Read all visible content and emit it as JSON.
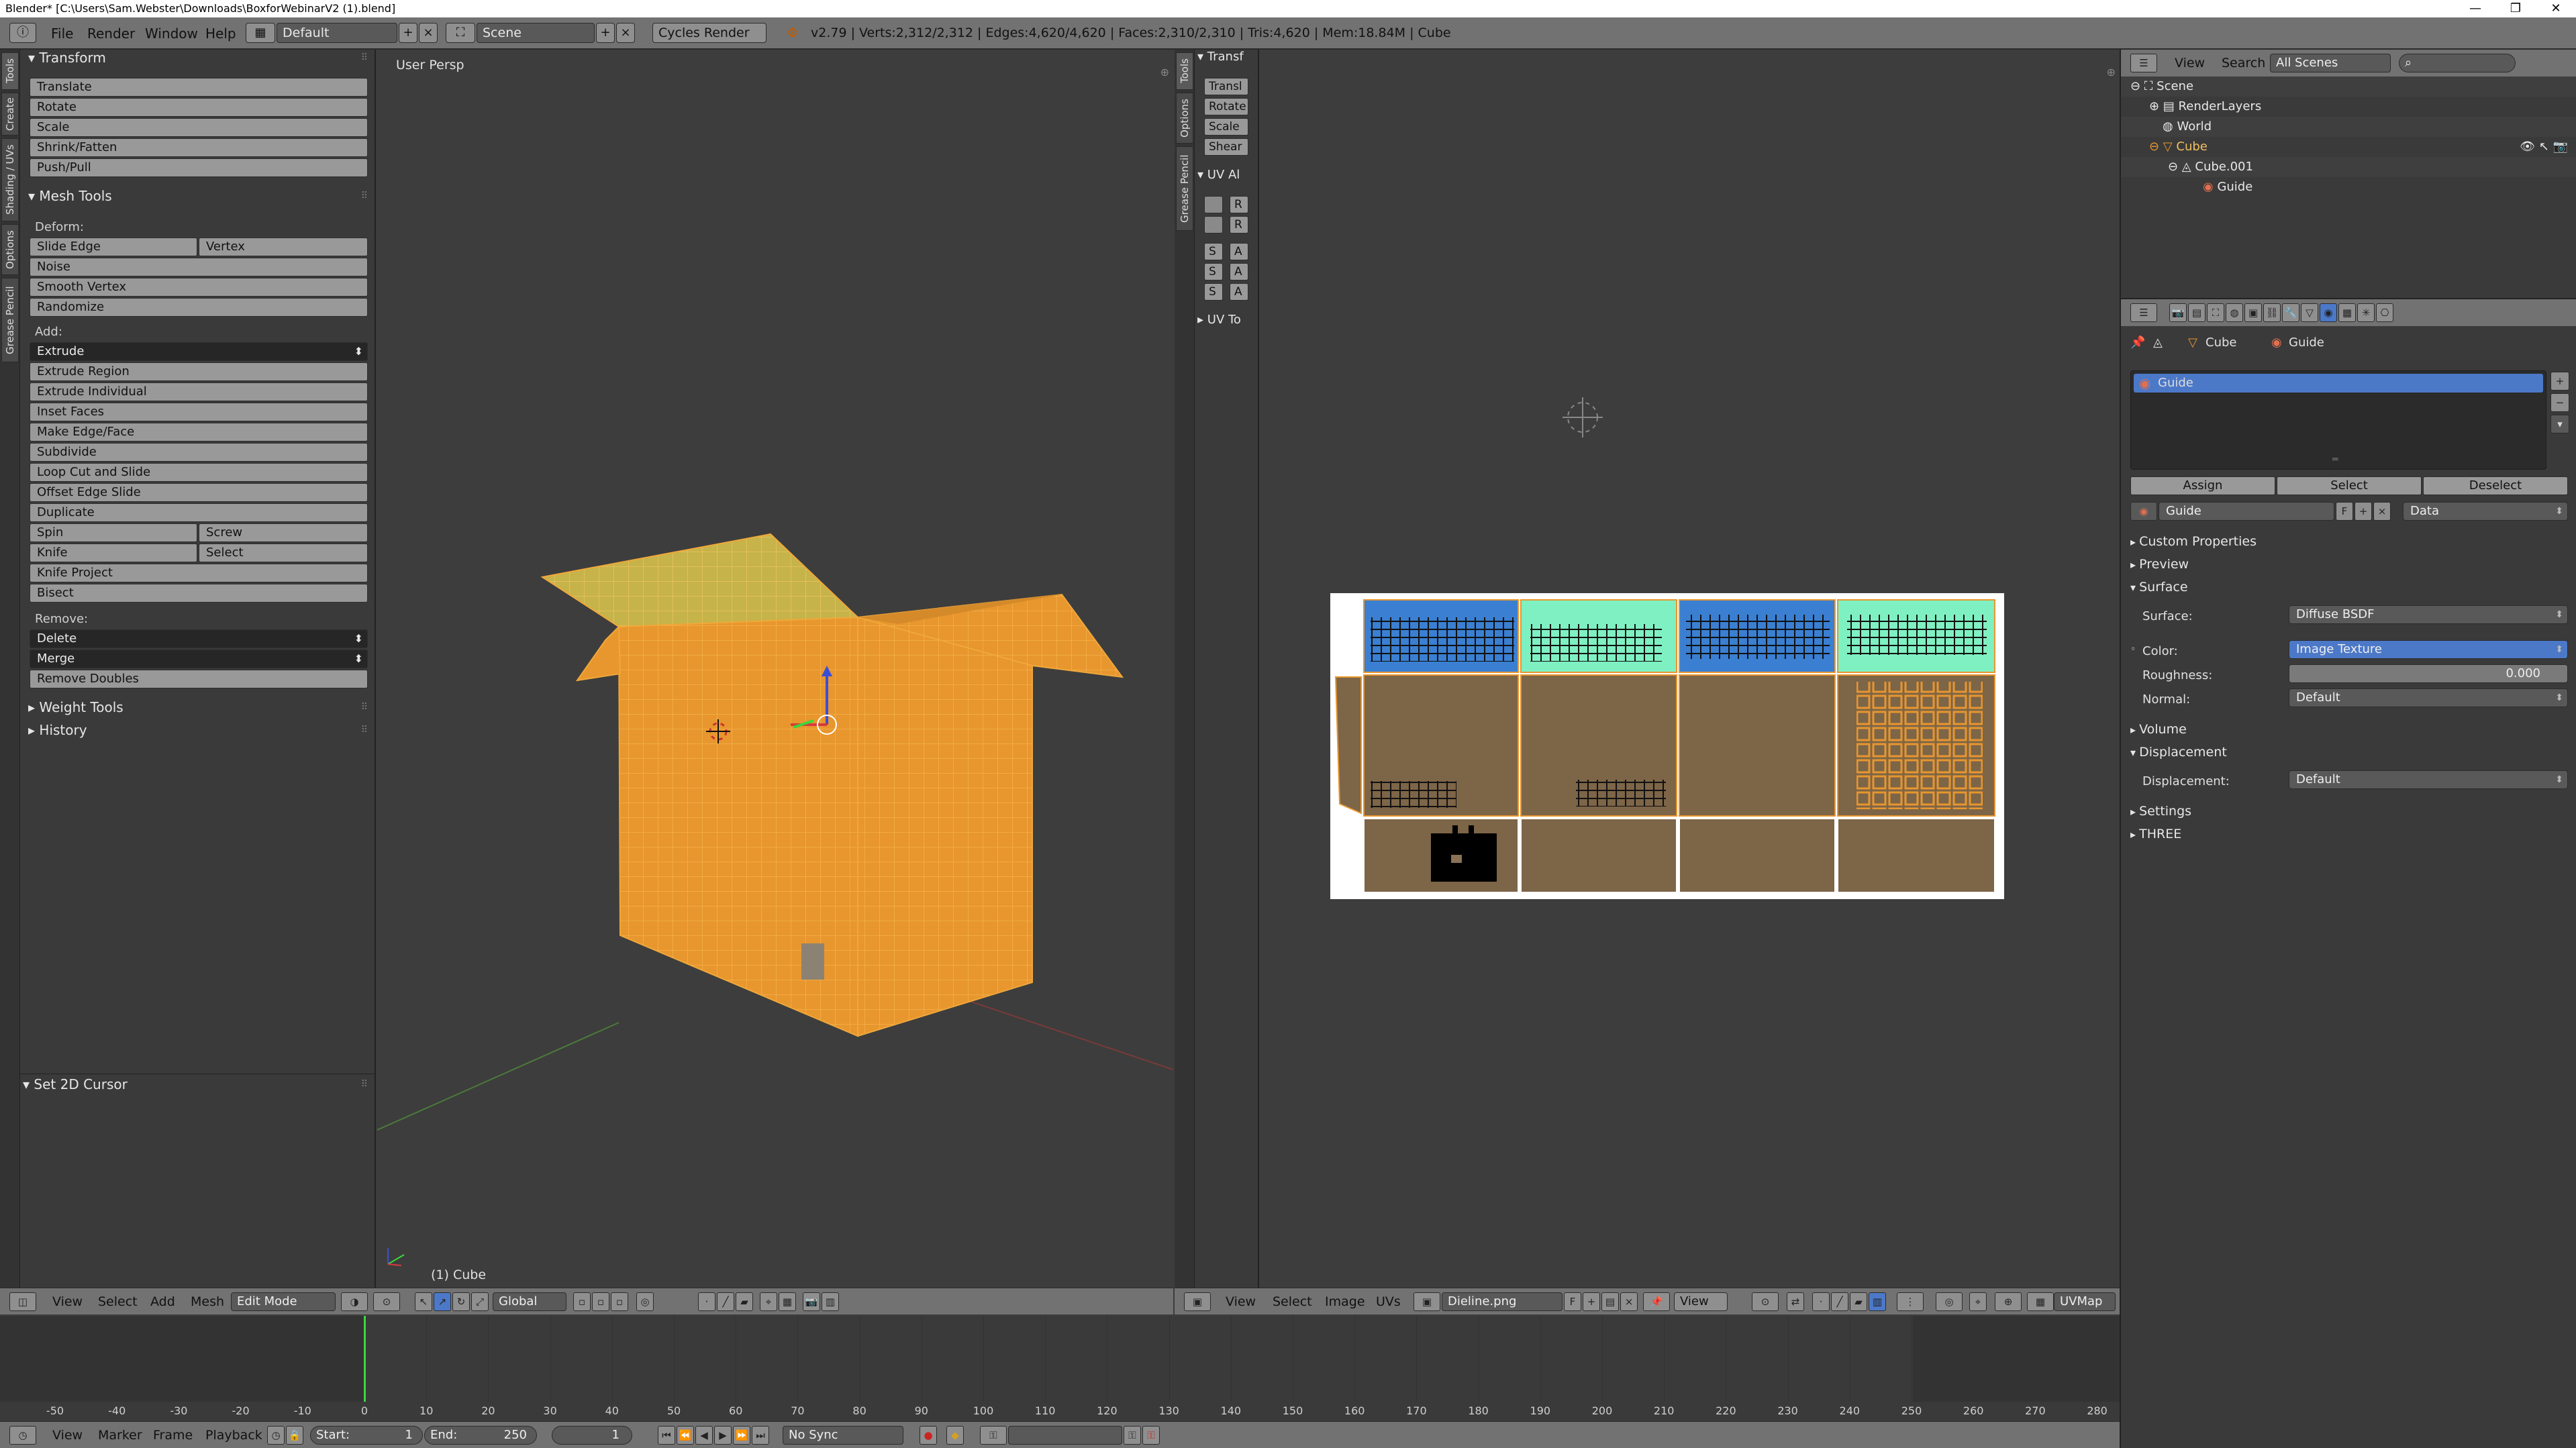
{
  "window": {
    "title": "Blender* [C:\\Users\\Sam.Webster\\Downloads\\BoxforWebinarV2 (1).blend]",
    "minimize": "—",
    "maximize": "❐",
    "close": "✕"
  },
  "header": {
    "menus": [
      "File",
      "Render",
      "Window",
      "Help"
    ],
    "layout": "Default",
    "scene": "Scene",
    "engine": "Cycles Render",
    "stats": "v2.79 | Verts:2,312/2,312 | Edges:4,620/4,620 | Faces:2,310/2,310 | Tris:4,620 | Mem:18.84M | Cube",
    "add_btn": "+",
    "remove_btn": "×"
  },
  "tool_tabs": [
    "Tools",
    "Create",
    "Shading / UVs",
    "Options",
    "Grease Pencil"
  ],
  "tool_shelf": {
    "transform": {
      "title": "Transform",
      "buttons": [
        "Translate",
        "Rotate",
        "Scale",
        "Shrink/Fatten",
        "Push/Pull"
      ]
    },
    "mesh_tools": {
      "title": "Mesh Tools",
      "deform_label": "Deform:",
      "slide_edge": "Slide Edge",
      "vertex": "Vertex",
      "deform_buttons": [
        "Noise",
        "Smooth Vertex",
        "Randomize"
      ],
      "add_label": "Add:",
      "extrude": "Extrude",
      "add_buttons": [
        "Extrude Region",
        "Extrude Individual",
        "Inset Faces",
        "Make Edge/Face",
        "Subdivide",
        "Loop Cut and Slide",
        "Offset Edge Slide",
        "Duplicate"
      ],
      "spin": "Spin",
      "screw": "Screw",
      "knife": "Knife",
      "select": "Select",
      "knife_project": "Knife Project",
      "bisect": "Bisect",
      "remove_label": "Remove:",
      "delete": "Delete",
      "merge": "Merge",
      "remove_doubles": "Remove Doubles"
    },
    "weight_tools": "Weight Tools",
    "history": "History",
    "set_2d_cursor": "Set 2D Cursor"
  },
  "viewport": {
    "label": "User Persp",
    "object": "(1) Cube",
    "header": {
      "menus": [
        "View",
        "Select",
        "Add",
        "Mesh"
      ],
      "mode": "Edit Mode",
      "orientation": "Global"
    }
  },
  "uv_side": {
    "tabs": [
      "Tools",
      "Options",
      "Grease Pencil"
    ],
    "transform_title": "Transf",
    "buttons": [
      "Transl",
      "Rotate",
      "Scale",
      "Shear"
    ],
    "uv_title": "UV Al",
    "uv_tools": "UV To",
    "small_buttons": [
      "R",
      "R",
      "S",
      "A",
      "S",
      "A",
      "S",
      "A"
    ]
  },
  "uv_editor": {
    "header": {
      "menus": [
        "View",
        "Select",
        "Image",
        "UVs"
      ],
      "image": "Dieline.png",
      "fake_user": "F",
      "view": "View",
      "uvmap": "UVMap"
    }
  },
  "outliner": {
    "header": {
      "view": "View",
      "search": "Search",
      "filter": "All Scenes"
    },
    "rows": [
      "Scene",
      "RenderLayers",
      "World",
      "Cube",
      "Cube.001",
      "Guide"
    ]
  },
  "properties": {
    "breadcrumb": [
      "Cube",
      "Guide"
    ],
    "material_slot": "Guide",
    "assign": "Assign",
    "select": "Select",
    "deselect": "Deselect",
    "material_name": "Guide",
    "fake_user": "F",
    "link": "Data",
    "sections": {
      "custom_properties": "Custom Properties",
      "preview": "Preview",
      "surface": "Surface",
      "volume": "Volume",
      "displacement": "Displacement",
      "settings": "Settings",
      "three": "THREE"
    },
    "surface_label": "Surface:",
    "surface_value": "Diffuse BSDF",
    "color_label": "Color:",
    "color_value": "Image Texture",
    "roughness_label": "Roughness:",
    "roughness_value": "0.000",
    "normal_label": "Normal:",
    "normal_value": "Default",
    "displacement_label": "Displacement:",
    "displacement_value": "Default"
  },
  "timeline": {
    "ticks": [
      "-50",
      "-40",
      "-30",
      "-20",
      "-10",
      "0",
      "10",
      "20",
      "30",
      "40",
      "50",
      "60",
      "70",
      "80",
      "90",
      "100",
      "110",
      "120",
      "130",
      "140",
      "150",
      "160",
      "170",
      "180",
      "190",
      "200",
      "210",
      "220",
      "230",
      "240",
      "250",
      "260",
      "270",
      "280"
    ],
    "current_frame": "1",
    "header": {
      "menus": [
        "View",
        "Marker",
        "Frame",
        "Playback"
      ],
      "start": "Start:",
      "start_value": "1",
      "end": "End:",
      "end_value": "250",
      "frame_value": "1",
      "sync": "No Sync"
    }
  },
  "colors": {
    "mesh_orange": "#e8962e",
    "face_select": "#d7a449",
    "panel_blue": "#3a7fd1",
    "panel_mint": "#7ff0c2",
    "cardboard": "#7d6548",
    "header": "#727272",
    "selected": "#4c78c8"
  }
}
